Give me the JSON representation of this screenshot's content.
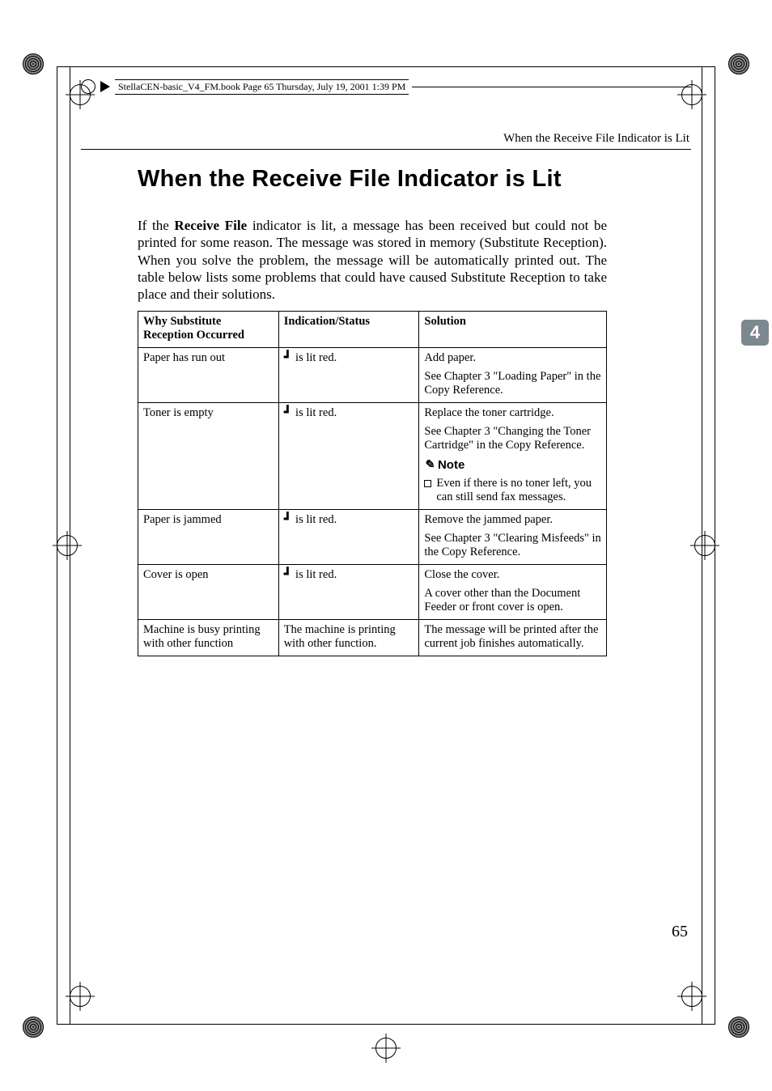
{
  "bookline": "StellaCEN-basic_V4_FM.book  Page 65  Thursday, July 19, 2001  1:39 PM",
  "running_head": "When the Receive File Indicator is Lit",
  "title": "When the Receive File Indicator is Lit",
  "paragraph_parts": {
    "p1": "If the ",
    "p2": "Receive File",
    "p3": " indicator is lit, a message has been received but could not be printed for some reason. The message was stored in memory (Substitute Reception). When you solve the problem, the message will be automatically printed out. The table below lists some problems that could have caused Substitute Reception to take place and their solutions."
  },
  "table": {
    "headers": {
      "a": "Why Substitute Reception Occurred",
      "b": "Indication/Status",
      "c": "Solution"
    },
    "lit_red": " is lit red.",
    "rows": {
      "r1": {
        "a": "Paper has run out",
        "c1": "Add paper.",
        "c2": "See Chapter 3 \"Loading Paper\" in the Copy Reference."
      },
      "r2": {
        "a": "Toner is empty",
        "c1": "Replace the toner cartridge.",
        "c2": "See Chapter 3 \"Changing the Toner Cartridge\" in the Copy Reference.",
        "note_label": "Note",
        "note_item": "Even if there is no toner left, you can still send fax messages."
      },
      "r3": {
        "a": "Paper is jammed",
        "c1": "Remove the jammed paper.",
        "c2": "See Chapter 3 \"Clearing Misfeeds\" in the Copy Reference."
      },
      "r4": {
        "a": "Cover is open",
        "c1": "Close the cover.",
        "c2": "A cover other than the Document Feeder or front cover is open."
      },
      "r5": {
        "a": "Machine is busy printing with other function",
        "b": "The machine is printing with other function.",
        "c1": "The message will be printed after the current job finishes automatically."
      }
    }
  },
  "tab_number": "4",
  "page_number": "65"
}
